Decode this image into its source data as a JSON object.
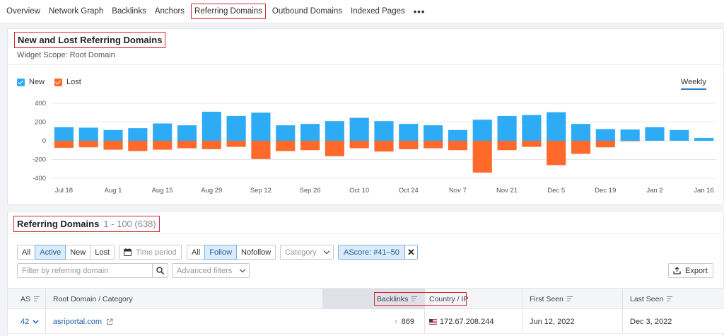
{
  "tabs": [
    {
      "label": "Overview",
      "active": false
    },
    {
      "label": "Network Graph",
      "active": false
    },
    {
      "label": "Backlinks",
      "active": false
    },
    {
      "label": "Anchors",
      "active": false
    },
    {
      "label": "Referring Domains",
      "active": true
    },
    {
      "label": "Outbound Domains",
      "active": false
    },
    {
      "label": "Indexed Pages",
      "active": false
    },
    {
      "label": "•••",
      "active": false
    }
  ],
  "widget": {
    "title": "New and Lost Referring Domains",
    "scope": "Widget Scope: Root Domain",
    "legend_new": "New",
    "legend_lost": "Lost",
    "period": "Weekly"
  },
  "colors": {
    "new": "#2eabf5",
    "lost": "#ff6a2b",
    "accent": "#2a7cd8",
    "highlight": "#d42a3a"
  },
  "chart_data": {
    "type": "bar",
    "stacked": true,
    "yticks": [
      400,
      200,
      0,
      -200,
      -400
    ],
    "ylim": [
      -400,
      400
    ],
    "grid": true,
    "legend": "top-left",
    "xtick_labels": [
      "Jul 18",
      "Aug 1",
      "Aug 15",
      "Aug 29",
      "Sep 12",
      "Sep 26",
      "Oct 10",
      "Oct 24",
      "Nov 7",
      "Nov 21",
      "Dec 5",
      "Dec 19",
      "Jan 2",
      "Jan 16"
    ],
    "series": [
      {
        "name": "New",
        "values": [
          145,
          140,
          115,
          135,
          185,
          165,
          310,
          265,
          300,
          165,
          180,
          210,
          245,
          210,
          180,
          165,
          115,
          225,
          265,
          275,
          305,
          180,
          125,
          120,
          145,
          115,
          30
        ]
      },
      {
        "name": "Lost",
        "values": [
          -75,
          -70,
          -95,
          -110,
          -95,
          -80,
          -90,
          -65,
          -195,
          -110,
          -100,
          -165,
          -80,
          -115,
          -90,
          -80,
          -100,
          -340,
          -100,
          -65,
          -260,
          -140,
          -70,
          -5,
          0,
          0,
          0
        ]
      }
    ]
  },
  "domains": {
    "title": "Referring Domains",
    "range": "1 - 100 (638)",
    "filters": {
      "status": [
        {
          "label": "All",
          "selected": false
        },
        {
          "label": "Active",
          "selected": true
        },
        {
          "label": "New",
          "selected": false
        },
        {
          "label": "Lost",
          "selected": false
        }
      ],
      "time_period": "Time period",
      "follow": [
        {
          "label": "All",
          "selected": false
        },
        {
          "label": "Follow",
          "selected": true
        },
        {
          "label": "Nofollow",
          "selected": false
        }
      ],
      "category": "Category",
      "ascore": "AScore: #41–50",
      "search_placeholder": "Filter by referring domain",
      "advanced": "Advanced filters",
      "export": "Export"
    },
    "columns": {
      "as": "AS",
      "root": "Root Domain / Category",
      "backlinks": "Backlinks",
      "country": "Country / IP",
      "first_seen": "First Seen",
      "last_seen": "Last Seen"
    },
    "rows": [
      {
        "as": "42",
        "domain": "asriportal.com",
        "backlinks": "869",
        "ip": "172.67.208.244",
        "first_seen": "Jun 12, 2022",
        "last_seen": "Dec 3, 2022"
      }
    ]
  }
}
